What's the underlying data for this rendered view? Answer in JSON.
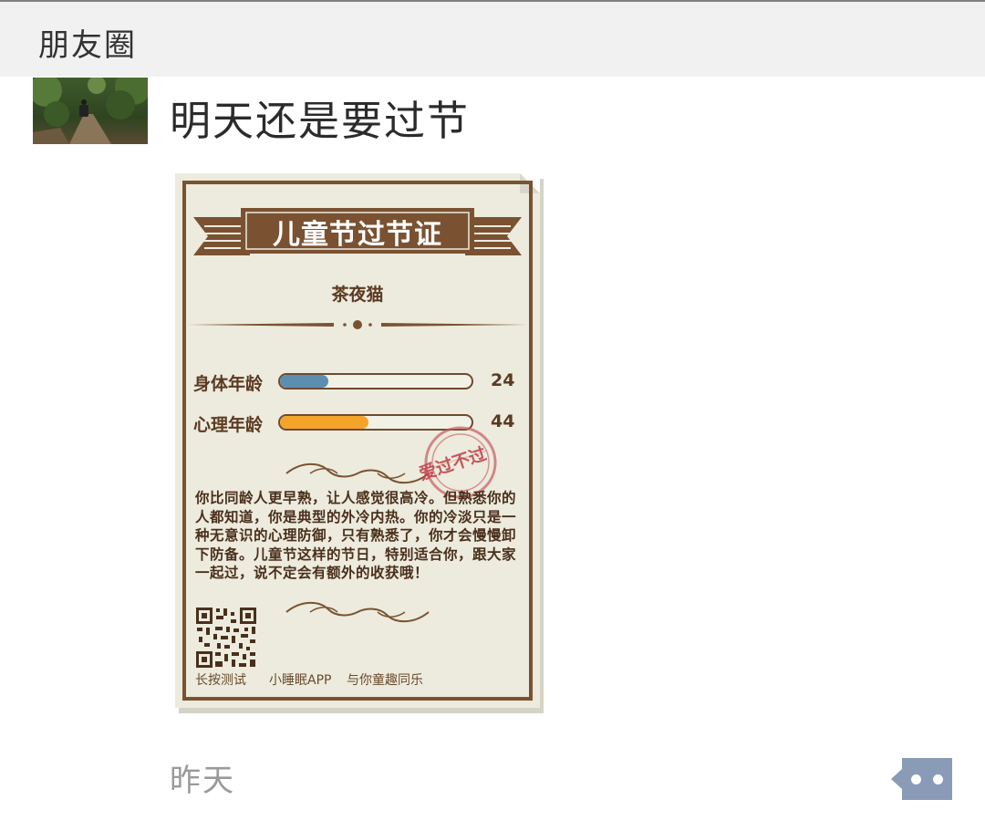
{
  "header": {
    "title": "朋友圈"
  },
  "post": {
    "text": "明天还是要过节",
    "time": "昨天"
  },
  "certificate": {
    "title": "儿童节过节证",
    "name": "茶夜猫",
    "body_age": {
      "label": "身体年龄",
      "value": "24",
      "fill_fraction": 0.25,
      "color": "#5b8eb0"
    },
    "mind_age": {
      "label": "心理年龄",
      "value": "44",
      "fill_fraction": 0.46,
      "color": "#f5a42a"
    },
    "stamp": "爱过不过",
    "description": "你比同龄人更早熟，让人感觉很高冷。但熟悉你的人都知道，你是典型的外冷内热。你的冷淡只是一种无意识的心理防御，只有熟悉了，你才会慢慢卸下防备。儿童节这样的节日，特别适合你，跟大家一起过，说不定会有额外的收获哦！",
    "footer": {
      "left": "长按测试",
      "middle": "小睡眠APP",
      "right": "与你童趣同乐"
    }
  },
  "colors": {
    "frame_brown": "#7a5232",
    "paper": "#ecebdd",
    "comment_button": "#8a9bb8"
  },
  "icons": {
    "comment": "comment-dots-icon"
  }
}
